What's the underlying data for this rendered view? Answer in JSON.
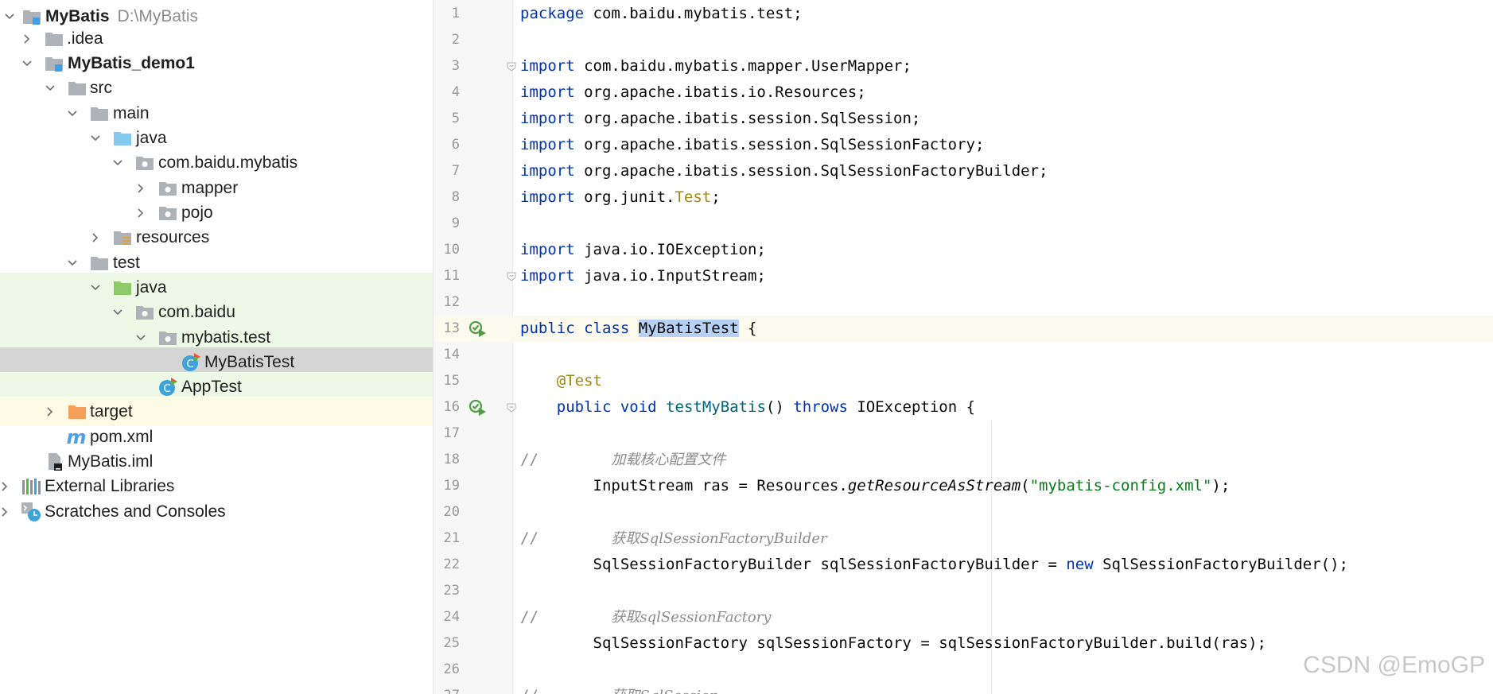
{
  "project_tree": [
    {
      "id": "mybatis",
      "label": "MyBatis",
      "hint": "D:\\MyBatis",
      "bold": true,
      "expanded": true,
      "icon": "module-folder-icon"
    },
    {
      "id": "idea",
      "label": ".idea",
      "expanded": false,
      "icon": "folder-icon"
    },
    {
      "id": "mybatis-demo1",
      "label": "MyBatis_demo1",
      "bold": true,
      "expanded": true,
      "icon": "module-folder-icon"
    },
    {
      "id": "src",
      "label": "src",
      "expanded": true,
      "icon": "folder-icon"
    },
    {
      "id": "main",
      "label": "main",
      "expanded": true,
      "icon": "folder-icon"
    },
    {
      "id": "main-java",
      "label": "java",
      "expanded": true,
      "icon": "source-root-icon"
    },
    {
      "id": "com-baidu-mybatis",
      "label": "com.baidu.mybatis",
      "expanded": true,
      "icon": "package-icon"
    },
    {
      "id": "mapper",
      "label": "mapper",
      "expanded": false,
      "icon": "package-icon"
    },
    {
      "id": "pojo",
      "label": "pojo",
      "expanded": false,
      "icon": "package-icon"
    },
    {
      "id": "resources",
      "label": "resources",
      "expanded": false,
      "icon": "resources-folder-icon"
    },
    {
      "id": "test",
      "label": "test",
      "expanded": true,
      "icon": "folder-icon"
    },
    {
      "id": "test-java",
      "label": "java",
      "expanded": true,
      "icon": "test-root-icon"
    },
    {
      "id": "com-baidu",
      "label": "com.baidu",
      "expanded": true,
      "icon": "package-icon"
    },
    {
      "id": "mybatis-test",
      "label": "mybatis.test",
      "expanded": true,
      "icon": "package-icon"
    },
    {
      "id": "mybatistest-class",
      "label": "MyBatisTest",
      "icon": "test-class-icon",
      "selected": true
    },
    {
      "id": "apptest-class",
      "label": "AppTest",
      "icon": "test-class-icon"
    },
    {
      "id": "target",
      "label": "target",
      "expanded": false,
      "icon": "excluded-folder-icon"
    },
    {
      "id": "pom",
      "label": "pom.xml",
      "icon": "maven-icon"
    },
    {
      "id": "iml",
      "label": "MyBatis.iml",
      "icon": "iml-file-icon"
    },
    {
      "id": "external-libraries",
      "label": "External Libraries",
      "expanded": false,
      "icon": "libraries-icon"
    },
    {
      "id": "scratches",
      "label": "Scratches and Consoles",
      "expanded": false,
      "icon": "scratches-icon"
    }
  ],
  "editor": {
    "current_line": 13,
    "lines": [
      {
        "n": "1",
        "tokens": [
          {
            "t": "package",
            "c": "kw"
          },
          {
            "t": " com.baidu.mybatis.test;"
          }
        ]
      },
      {
        "n": "2",
        "tokens": []
      },
      {
        "n": "3",
        "fold": true,
        "tokens": [
          {
            "t": "import",
            "c": "kw"
          },
          {
            "t": " com.baidu.mybatis.mapper.UserMapper;"
          }
        ]
      },
      {
        "n": "4",
        "tokens": [
          {
            "t": "import",
            "c": "kw"
          },
          {
            "t": " org.apache.ibatis.io.Resources;"
          }
        ]
      },
      {
        "n": "5",
        "tokens": [
          {
            "t": "import",
            "c": "kw"
          },
          {
            "t": " org.apache.ibatis.session.SqlSession;"
          }
        ]
      },
      {
        "n": "6",
        "tokens": [
          {
            "t": "import",
            "c": "kw"
          },
          {
            "t": " org.apache.ibatis.session.SqlSessionFactory;"
          }
        ]
      },
      {
        "n": "7",
        "tokens": [
          {
            "t": "import",
            "c": "kw"
          },
          {
            "t": " org.apache.ibatis.session.SqlSessionFactoryBuilder;"
          }
        ]
      },
      {
        "n": "8",
        "tokens": [
          {
            "t": "import",
            "c": "kw"
          },
          {
            "t": " org.junit."
          },
          {
            "t": "Test",
            "c": "ann"
          },
          {
            "t": ";"
          }
        ]
      },
      {
        "n": "9",
        "tokens": []
      },
      {
        "n": "10",
        "tokens": [
          {
            "t": "import",
            "c": "kw"
          },
          {
            "t": " java.io.IOException;"
          }
        ]
      },
      {
        "n": "11",
        "fold": true,
        "tokens": [
          {
            "t": "import",
            "c": "kw"
          },
          {
            "t": " java.io.InputStream;"
          }
        ]
      },
      {
        "n": "12",
        "tokens": []
      },
      {
        "n": "13",
        "run": true,
        "tokens": [
          {
            "t": "public",
            "c": "kw"
          },
          {
            "t": " "
          },
          {
            "t": "class",
            "c": "kw"
          },
          {
            "t": " "
          },
          {
            "t": "MyBatisTest",
            "c": "hl"
          },
          {
            "t": " {"
          }
        ]
      },
      {
        "n": "14",
        "tokens": []
      },
      {
        "n": "15",
        "tokens": [
          {
            "t": "    "
          },
          {
            "t": "@Test",
            "c": "ann"
          }
        ]
      },
      {
        "n": "16",
        "run": true,
        "fold": true,
        "tokens": [
          {
            "t": "    "
          },
          {
            "t": "public",
            "c": "kw"
          },
          {
            "t": " "
          },
          {
            "t": "void",
            "c": "kw"
          },
          {
            "t": " "
          },
          {
            "t": "testMyBatis",
            "c": "fn"
          },
          {
            "t": "() "
          },
          {
            "t": "throws",
            "c": "kw"
          },
          {
            "t": " IOException {"
          }
        ]
      },
      {
        "n": "17",
        "tokens": []
      },
      {
        "n": "18",
        "tokens": [
          {
            "t": "//        ",
            "c": "cmt"
          },
          {
            "t": "加载核心配置文件",
            "c": "cmti"
          }
        ]
      },
      {
        "n": "19",
        "tokens": [
          {
            "t": "        InputStream ras = Resources."
          },
          {
            "t": "getResourceAsStream",
            "c": "it"
          },
          {
            "t": "("
          },
          {
            "t": "\"mybatis-config.xml\"",
            "c": "str"
          },
          {
            "t": ");"
          }
        ]
      },
      {
        "n": "20",
        "tokens": []
      },
      {
        "n": "21",
        "tokens": [
          {
            "t": "//        ",
            "c": "cmt"
          },
          {
            "t": "获取SqlSessionFactoryBuilder",
            "c": "cmti"
          }
        ]
      },
      {
        "n": "22",
        "tokens": [
          {
            "t": "        SqlSessionFactoryBuilder sqlSessionFactoryBuilder = "
          },
          {
            "t": "new",
            "c": "kw"
          },
          {
            "t": " SqlSessionFactoryBuilder();"
          }
        ]
      },
      {
        "n": "23",
        "tokens": []
      },
      {
        "n": "24",
        "tokens": [
          {
            "t": "//        ",
            "c": "cmt"
          },
          {
            "t": "获取sqlSessionFactory",
            "c": "cmti"
          }
        ]
      },
      {
        "n": "25",
        "tokens": [
          {
            "t": "        SqlSessionFactory sqlSessionFactory = sqlSessionFactoryBuilder.build(ras);"
          }
        ]
      },
      {
        "n": "26",
        "tokens": []
      },
      {
        "n": "27",
        "tokens": [
          {
            "t": "//        ",
            "c": "cmt"
          },
          {
            "t": "获取SqlSession",
            "c": "cmti"
          }
        ]
      }
    ]
  },
  "watermark": "CSDN @EmoGP"
}
